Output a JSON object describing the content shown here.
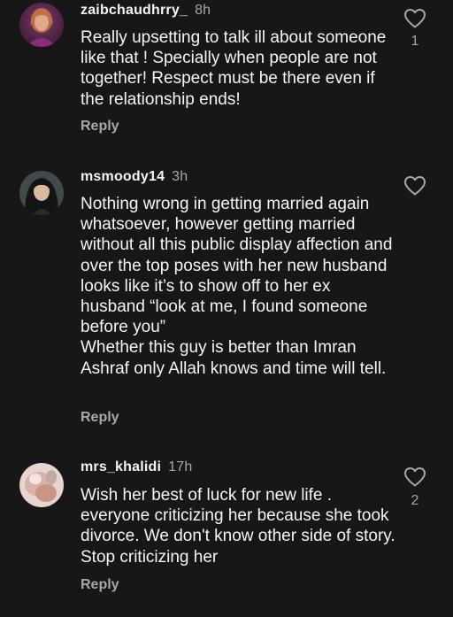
{
  "comments": [
    {
      "username": "zaibchaudhrry_",
      "time": "8h",
      "text": "Really upsetting to talk ill about someone like that ! Specially when people are not together! Respect must be there even if the relationship ends!",
      "reply_label": "Reply",
      "likes": "1",
      "avatar_icon": "user-avatar"
    },
    {
      "username": "msmoody14",
      "time": "3h",
      "text": "Nothing wrong in getting married again whatsoever, however getting married without all this public display affection and over the top poses with her new husband looks like it’s to show off to her ex husband “look at me, I found someone before you”\nWhether this guy is better than Imran Ashraf only Allah knows and time will tell.",
      "reply_label": "Reply",
      "likes": "",
      "avatar_icon": "user-avatar"
    },
    {
      "username": "mrs_khalidi",
      "time": "17h",
      "text": "Wish her best of luck for new life . everyone  criticizing her because she took divorce. We don't know other side of story. Stop criticizing her",
      "reply_label": "Reply",
      "likes": "2",
      "avatar_icon": "user-avatar"
    }
  ],
  "colors": {
    "background": "#171717",
    "primary_text": "#f5f5f5",
    "secondary_text": "#a8a8a8"
  },
  "icons": {
    "like": "heart-outline-icon"
  }
}
